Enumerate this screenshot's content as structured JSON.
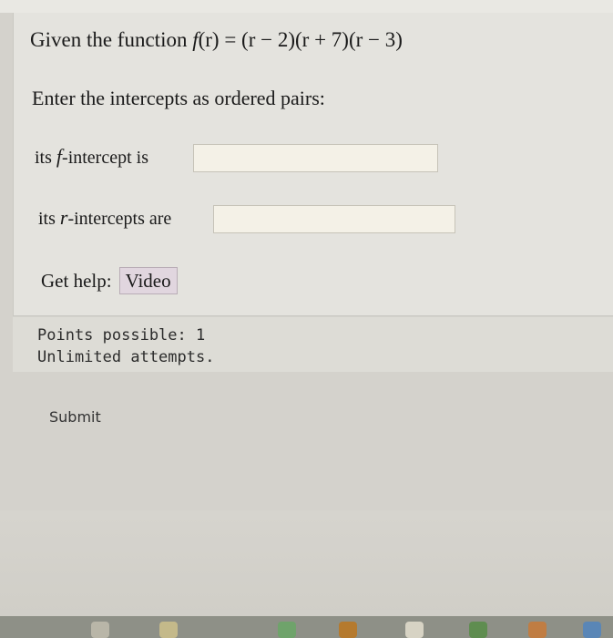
{
  "question": {
    "function_prefix": "Given the function ",
    "function_name": "f",
    "function_expr": "(r) = (r − 2)(r + 7)(r − 3)",
    "instruction": "Enter the intercepts as ordered pairs:",
    "f_intercept_prefix": "its ",
    "f_intercept_var": "f",
    "f_intercept_suffix": "-intercept is",
    "r_intercept_prefix": "its ",
    "r_intercept_var": "r",
    "r_intercept_suffix": "-intercepts are",
    "f_intercept_value": "",
    "r_intercepts_value": ""
  },
  "help": {
    "label": "Get help:",
    "video_label": "Video"
  },
  "info": {
    "points": "Points possible: 1",
    "attempts": "Unlimited attempts."
  },
  "actions": {
    "submit_label": "Submit"
  },
  "colors": {
    "panel_bg": "#e4e3de",
    "answer_box_bg": "#f4f1e7",
    "video_button_bg": "#e1d6df"
  }
}
